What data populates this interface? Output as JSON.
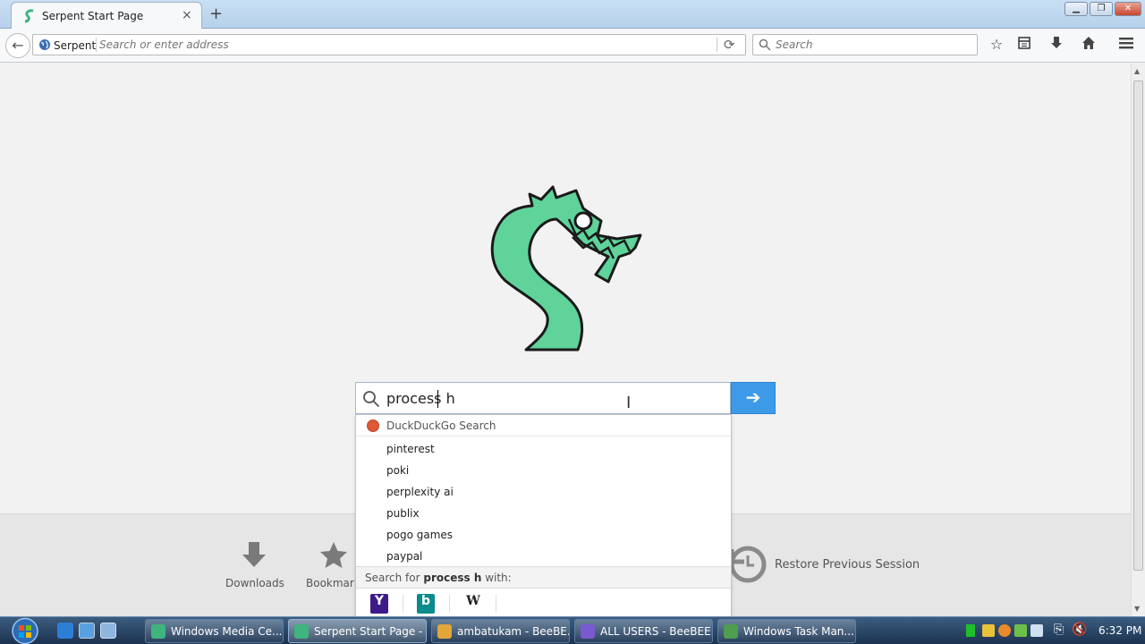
{
  "browser": {
    "tab_title": "Serpent Start Page",
    "new_tab_symbol": "+",
    "close_tab_symbol": "×",
    "identity_label": "Serpent",
    "address_placeholder": "Search or enter address",
    "search_placeholder": "Search"
  },
  "start_page": {
    "search_value": "process h",
    "submit_arrow": "➔",
    "launcher": {
      "downloads": "Downloads",
      "bookmarks": "Bookmark",
      "restore": "Restore Previous Session"
    }
  },
  "autocomplete": {
    "engine_header": "DuckDuckGo Search",
    "suggestions": [
      "pinterest",
      "poki",
      "perplexity ai",
      "publix",
      "pogo games",
      "paypal"
    ],
    "search_for_prefix": "Search for ",
    "search_for_term": "process h",
    "search_for_suffix": " with:",
    "engines": [
      "Y",
      "b",
      "W"
    ]
  },
  "taskbar": {
    "buttons": [
      "Windows Media Ce...",
      "Serpent Start Page - ...",
      "ambatukam - BeeBE...",
      "ALL USERS - BeeBEE...",
      "Windows Task Man..."
    ],
    "clock": "6:32 PM"
  },
  "colors": {
    "accent": "#3d9ae8",
    "serpent_green": "#5fd39a"
  }
}
